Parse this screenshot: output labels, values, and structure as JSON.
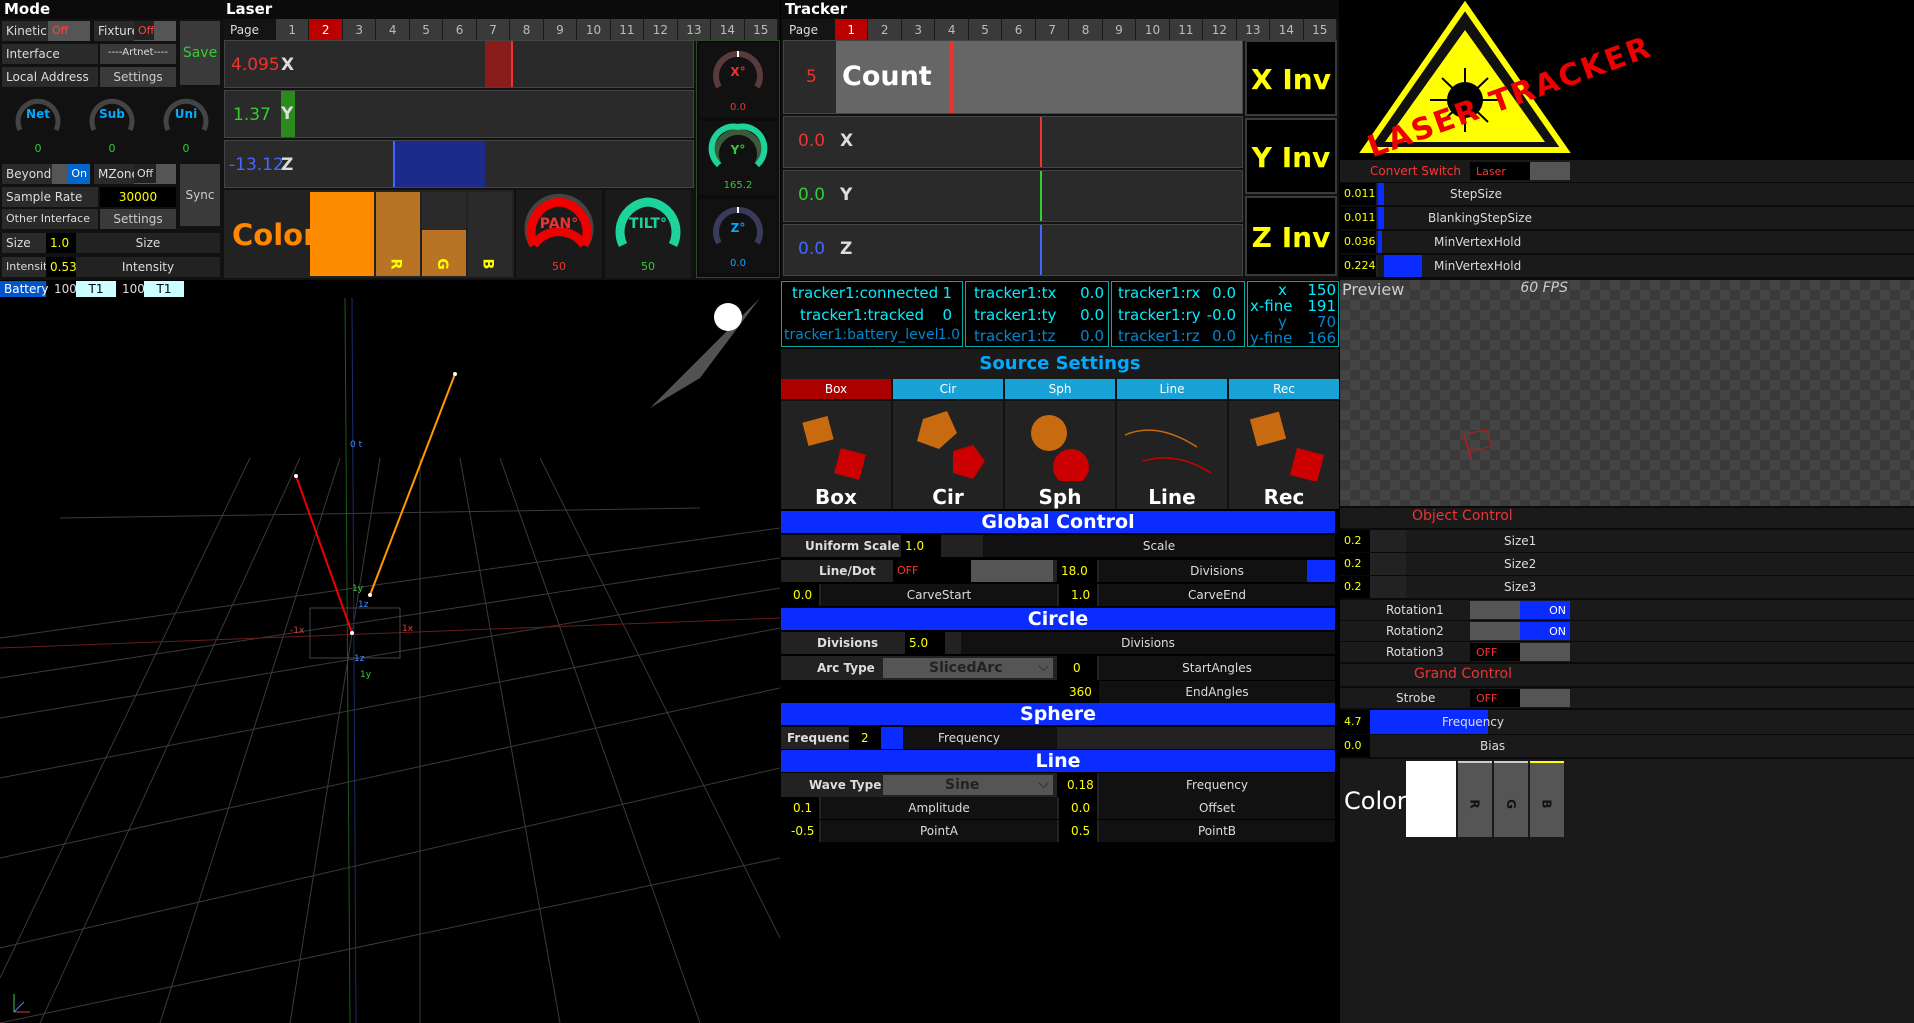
{
  "mode": {
    "title": "Mode",
    "kinetic": "Kinetic",
    "kinetic_val": "Off",
    "fixture": "Fixture",
    "fixture_val": "Off",
    "interface": "Interface",
    "artnet": "----Artnet----",
    "local_address": "Local Address",
    "settings1": "Settings",
    "save": "Save",
    "net": "Net",
    "sub": "Sub",
    "uni": "Uni",
    "net_v": "0",
    "sub_v": "0",
    "uni_v": "0",
    "beyond": "Beyond",
    "beyond_val": "On",
    "mzone": "MZone",
    "mzone_val": "Off",
    "sample_rate": "Sample Rate",
    "sample_rate_v": "30000",
    "sync": "Sync",
    "other_interface": "Other Interface",
    "settings2": "Settings",
    "size": "Size",
    "size_v": "1.0",
    "size_lbl": "Size",
    "intensity": "Intensity",
    "intensity_v": "0.53",
    "intensity_lbl": "Intensity",
    "battery": "Battery",
    "bat1": "100",
    "t1a": "T1",
    "bat2": "100",
    "t1b": "T1"
  },
  "laser": {
    "title": "Laser",
    "page": "Page",
    "pages": [
      "1",
      "2",
      "3",
      "4",
      "5",
      "6",
      "7",
      "8",
      "9",
      "10",
      "11",
      "12",
      "13",
      "14",
      "15"
    ],
    "selected_page": "2",
    "x_val": "4.095",
    "x": "X",
    "y_val": "1.37",
    "y": "Y",
    "z_val": "-13.12",
    "z": "Z",
    "color": "Color",
    "r": "R",
    "g": "G",
    "b": "B",
    "x_knob": "X°",
    "x_knob_v": "0.0",
    "y_knob": "Y°",
    "y_knob_v": "165.2",
    "z_knob": "Z°",
    "z_knob_v": "0.0",
    "pan": "PAN°",
    "pan_v": "50",
    "tilt": "TILT°",
    "tilt_v": "50"
  },
  "tracker": {
    "title": "Tracker",
    "page": "Page",
    "pages": [
      "1",
      "2",
      "3",
      "4",
      "5",
      "6",
      "7",
      "8",
      "9",
      "10",
      "11",
      "12",
      "13",
      "14",
      "15"
    ],
    "selected_page": "1",
    "count_v": "5",
    "count": "Count",
    "x_v": "0.0",
    "x": "X",
    "y_v": "0.0",
    "y": "Y",
    "z_v": "0.0",
    "z": "Z",
    "x_inv": "X Inv",
    "y_inv": "Y Inv",
    "z_inv": "Z Inv",
    "connected": "tracker1:connected",
    "connected_v": "1",
    "tracked": "tracker1:tracked",
    "tracked_v": "0",
    "battery": "tracker1:battery_level",
    "battery_v": "1.0",
    "tx": "tracker1:tx",
    "tx_v": "0.0",
    "ty": "tracker1:ty",
    "ty_v": "0.0",
    "tz": "tracker1:tz",
    "tz_v": "0.0",
    "rx": "tracker1:rx",
    "rx_v": "0.0",
    "ry": "tracker1:ry",
    "ry_v": "-0.0",
    "rz": "tracker1:rz",
    "rz_v": "0.0",
    "xx": "x",
    "xx_v": "150",
    "xfine": "x-fine",
    "xfine_v": "191",
    "yy": "y",
    "yy_v": "70",
    "yfine": "y-fine",
    "yfine_v": "166"
  },
  "source": {
    "title": "Source Settings",
    "tabs": [
      "Box",
      "Cir",
      "Sph",
      "Line",
      "Rec"
    ],
    "names": [
      "Box",
      "Cir",
      "Sph",
      "Line",
      "Rec"
    ]
  },
  "global": {
    "title": "Global Control",
    "uniform_scale": "Uniform Scale",
    "uniform_v": "1.0",
    "scale": "Scale",
    "linedot": "Line/Dot",
    "linedot_v": "OFF",
    "div_v": "18.0",
    "divisions": "Divisions",
    "cs_v": "0.0",
    "carvestart": "CarveStart",
    "ce_v": "1.0",
    "carveend": "CarveEnd"
  },
  "circle": {
    "title": "Circle",
    "divisions": "Divisions",
    "div_v": "5.0",
    "divisions2": "Divisions",
    "arc_type": "Arc Type",
    "arc_v": "SlicedArc",
    "sa_v": "0",
    "startangles": "StartAngles",
    "ea_v": "360",
    "endangles": "EndAngles"
  },
  "sphere": {
    "title": "Sphere",
    "frequency": "Frequency",
    "freq_v": "2",
    "frequency2": "Frequency"
  },
  "line": {
    "title": "Line",
    "wave_type": "Wave Type",
    "wave_v": "Sine",
    "freq_v": "0.18",
    "frequency": "Frequency",
    "amp_v": "0.1",
    "amplitude": "Amplitude",
    "off_v": "0.0",
    "offset": "Offset",
    "pa_v": "-0.5",
    "pointa": "PointA",
    "pb_v": "0.5",
    "pointb": "PointB"
  },
  "right": {
    "logo_text": "LASER TRACKER",
    "convert_switch": "Convert Switch",
    "convert_v": "Laser",
    "step_v": "0.011",
    "stepsize": "StepSize",
    "bstep_v": "0.011",
    "blankingstepsize": "BlankingStepSize",
    "mvh1_v": "0.036",
    "minvertexhold1": "MinVertexHold",
    "mvh2_v": "0.224",
    "minvertexhold2": "MinVertexHold",
    "preview": "Preview",
    "fps": "60 FPS",
    "object_control": "Object Control",
    "s1_v": "0.2",
    "size1": "Size1",
    "s2_v": "0.2",
    "size2": "Size2",
    "s3_v": "0.2",
    "size3": "Size3",
    "rotation1": "Rotation1",
    "rot1_v": "ON",
    "rotation2": "Rotation2",
    "rot2_v": "ON",
    "rotation3": "Rotation3",
    "rot3_v": "OFF",
    "grand_control": "Grand Control",
    "strobe": "Strobe",
    "strobe_v": "OFF",
    "gfreq_v": "4.7",
    "frequency": "Frequency",
    "bias_v": "0.0",
    "bias": "Bias",
    "color": "Color",
    "r": "R",
    "g": "G",
    "b": "B"
  },
  "viewport": {
    "labels": [
      "-1x",
      "1x",
      "1y",
      "1z",
      "1y",
      "1z",
      "0 t"
    ]
  },
  "colors": {
    "accent": "#0a2cff",
    "red": "#e00000",
    "yellow": "#ffff00",
    "cyan": "#00e5ff",
    "orange": "#ff8c00"
  }
}
